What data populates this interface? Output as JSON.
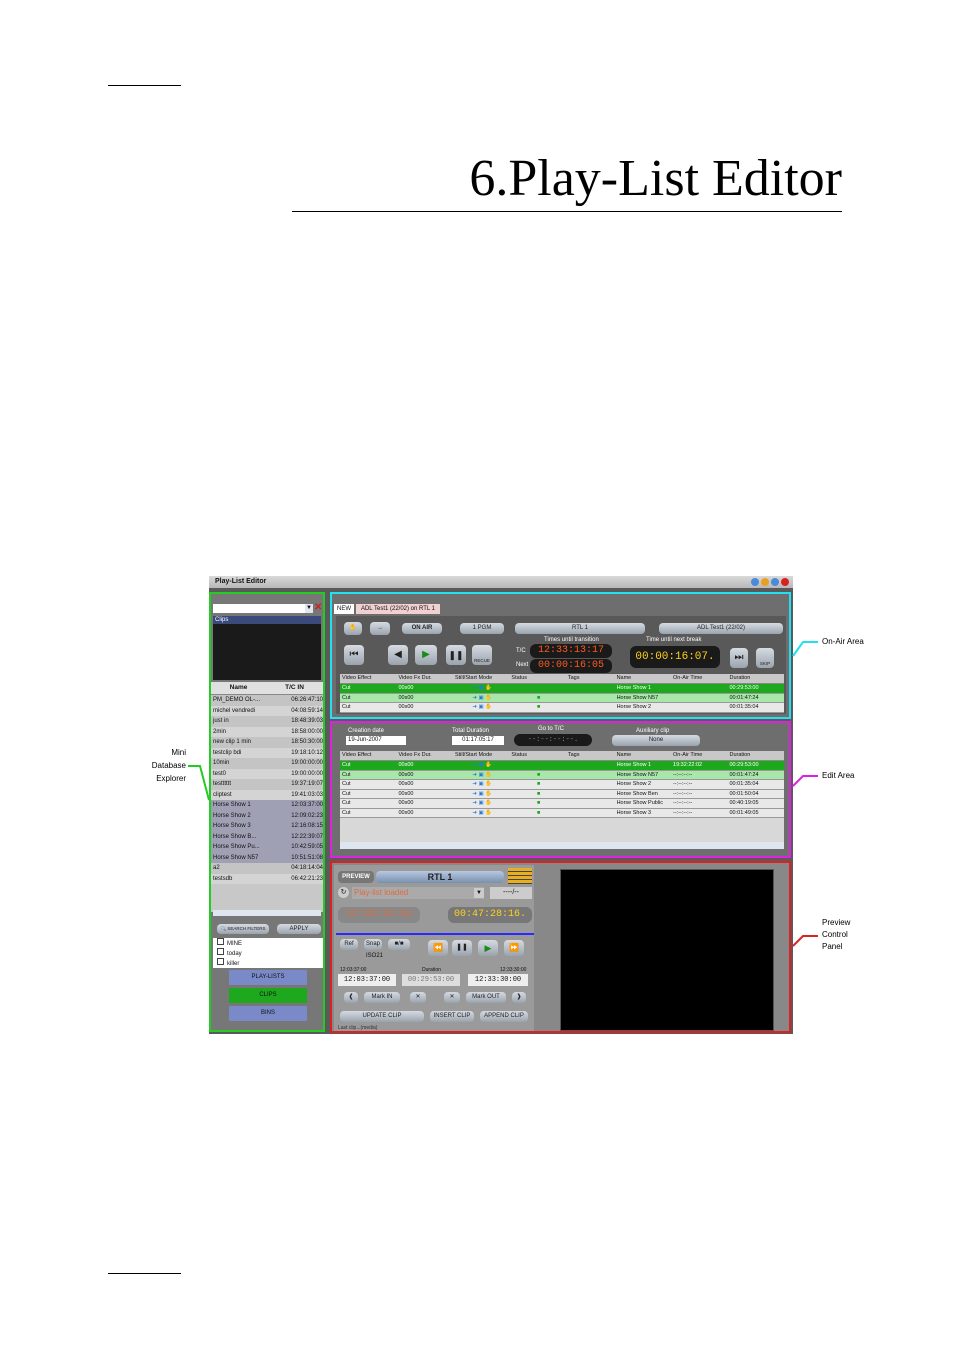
{
  "chapter": {
    "title": "6.Play-List Editor"
  },
  "screenshot": {
    "window_title": "Play-List Editor",
    "explorer": {
      "tree_item": "Clips",
      "columns": [
        "Name",
        "T/C IN"
      ],
      "rows": [
        {
          "name": "PM_DEMO  OL-...",
          "tc": "06:26:47:10"
        },
        {
          "name": "michel vendredi",
          "tc": "04:08:59:14"
        },
        {
          "name": "just in",
          "tc": "18:48:39:03"
        },
        {
          "name": "2min",
          "tc": "18:58:00:00"
        },
        {
          "name": "new clip 1 min",
          "tc": "18:50:30:00"
        },
        {
          "name": "testclip bdi",
          "tc": "19:18:10:12"
        },
        {
          "name": "10min",
          "tc": "19:00:00:00"
        },
        {
          "name": "test0",
          "tc": "19:00:00:00"
        },
        {
          "name": "testttttt",
          "tc": "19:37:19:07"
        },
        {
          "name": "cliptest",
          "tc": "19:41:03:03"
        },
        {
          "name": "Horse Show 1",
          "tc": "12:03:37:00"
        },
        {
          "name": "Horse Show 2",
          "tc": "12:09:02:23"
        },
        {
          "name": "Horse Show 3",
          "tc": "12:16:08:15"
        },
        {
          "name": "Horse Show B...",
          "tc": "12:22:39:07"
        },
        {
          "name": "Horse Show Pu...",
          "tc": "10:42:59:05"
        },
        {
          "name": "Horse Show N57",
          "tc": "10:51:51:08"
        },
        {
          "name": "a2",
          "tc": "04:18:14:04"
        },
        {
          "name": "testsdb",
          "tc": "06:42:21:23"
        }
      ],
      "search_filters_label": "SEARCH FILTERS",
      "apply_label": "APPLY",
      "filters": [
        "MINE",
        "today",
        "killer"
      ],
      "nav": {
        "playlists": "PLAY-LISTS",
        "clips": "CLIPS",
        "bins": "BINS"
      }
    },
    "onair": {
      "tabs": [
        "NEW",
        "ADL Test1 (22/02) on RTL 1"
      ],
      "on_air_label": "ON AIR",
      "pgm_label": "1 PGM",
      "channel_label": "RTL 1",
      "playlist_label": "ADL Test1 (22/02)",
      "times_until_transition": "Times until transition",
      "time_until_break": "Time until next break",
      "tc_label": "T/C",
      "next_label": "Next",
      "tc_value": "12:33:13:17",
      "next_value": "00:00:16:05",
      "break_value": "00:00:16:07.",
      "recue_label": "RECUE",
      "skip_label": "SKIP",
      "columns": [
        "Video Effect",
        "Video Fx Dur.",
        "Still/Start Mode",
        "Status",
        "Tags",
        "Name",
        "On-Air Time",
        "Duration"
      ],
      "rows": [
        {
          "effect": "Cut",
          "dur": "00s00",
          "name": "Horse Show 1",
          "time": "",
          "duration": "00:29:53:00"
        },
        {
          "effect": "Cut",
          "dur": "00s00",
          "name": "Horse Show N57",
          "time": "",
          "duration": "00:01:47:24"
        },
        {
          "effect": "Cut",
          "dur": "00s00",
          "name": "Horse Show 2",
          "time": "",
          "duration": "00:01:35:04"
        }
      ]
    },
    "edit": {
      "creation_date_label": "Creation date",
      "creation_date": "19-Jun-2007",
      "total_duration_label": "Total Duration",
      "total_duration": "01:17:05:17",
      "goto_label": "Go to T/C",
      "goto_value": "--:--:--:--.",
      "aux_label": "Auxiliary clip",
      "aux_value": "None",
      "columns": [
        "Video Effect",
        "Video Fx Dur.",
        "Still/Start Mode",
        "Status",
        "Tags",
        "Name",
        "On-Air Time",
        "Duration"
      ],
      "rows": [
        {
          "effect": "Cut",
          "dur": "00s00",
          "name": "Horse Show 1",
          "time": "19:32:22:02",
          "duration": "00:29:53:00"
        },
        {
          "effect": "Cut",
          "dur": "00s00",
          "name": "Horse Show N57",
          "time": "--:--:--:--",
          "duration": "00:01:47:24"
        },
        {
          "effect": "Cut",
          "dur": "00s00",
          "name": "Horse Show 2",
          "time": "--:--:--:--",
          "duration": "00:01:35:04"
        },
        {
          "effect": "Cut",
          "dur": "00s00",
          "name": "Horse Show Ben",
          "time": "--:--:--:--",
          "duration": "00:01:50:04"
        },
        {
          "effect": "Cut",
          "dur": "00s00",
          "name": "Horse Show Public",
          "time": "--:--:--:--",
          "duration": "00:40:19:05"
        },
        {
          "effect": "Cut",
          "dur": "00s00",
          "name": "Horse Show 3",
          "time": "--:--:--:--",
          "duration": "00:01:49:05"
        }
      ]
    },
    "preview": {
      "preview_label": "PREVIEW",
      "channel_label": "RTL 1",
      "status_text": "Play-list loaded",
      "counter": "----/--",
      "tc_left": "12:33:13:14",
      "tc_right": "00:47:28:16.",
      "ref_label": "Ref",
      "snap_label": "Snap",
      "iso_label": "ISO21",
      "tc_start_label": "12:03:37:00",
      "duration_label": "Duration",
      "tc_end_label": "12:33:30:00",
      "in_value": "12:03:37:00",
      "dur_value": "00:29:53:00",
      "out_value": "12:33:30:00",
      "mark_in_label": "Mark IN",
      "mark_out_label": "Mark OUT",
      "update_clip_label": "UPDATE CLIP",
      "insert_clip_label": "INSERT CLIP",
      "append_clip_label": "APPEND CLIP",
      "footer_text": "Last clip...(media)"
    }
  },
  "callouts": {
    "onair": "On-Air Area",
    "explorer": [
      "Mini",
      "Database",
      "Explorer"
    ],
    "edit": "Edit Area",
    "preview": [
      "Preview",
      "Control",
      "Panel"
    ]
  },
  "colors": {
    "onair": "#22e0f0",
    "edit": "#e020e0",
    "explorer": "#22cc22",
    "preview": "#e02020"
  }
}
